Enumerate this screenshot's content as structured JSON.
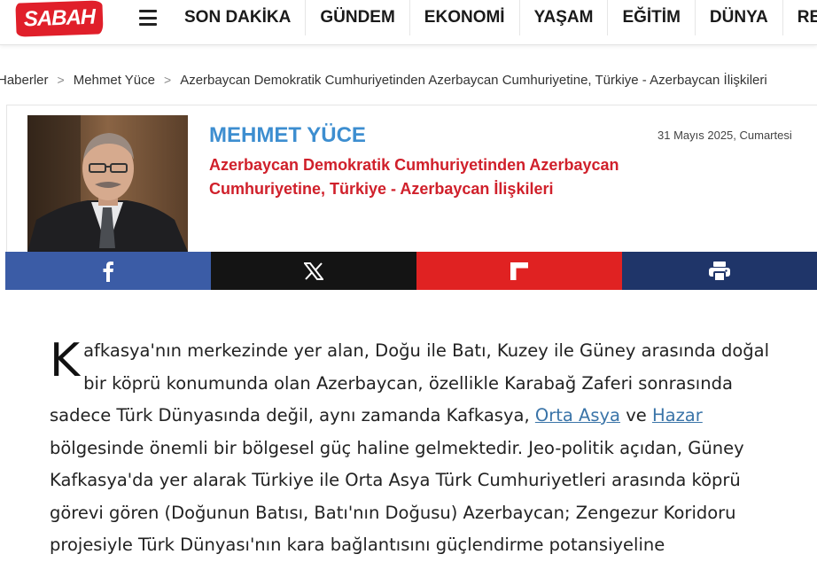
{
  "header": {
    "logo_text": "SABAH",
    "nav": [
      "SON DAKİKA",
      "GÜNDEM",
      "EKONOMİ",
      "YAŞAM",
      "EĞİTİM",
      "DÜNYA",
      "RES"
    ]
  },
  "breadcrumb": [
    "Haberler",
    "Mehmet Yüce",
    "Azerbaycan Demokratik Cumhuriyetinden Azerbaycan Cumhuriyetine, Türkiye - Azerbaycan İlişkileri"
  ],
  "author": {
    "name": "MEHMET YÜCE",
    "date": "31 Mayıs 2025, Cumartesi",
    "headline": "Azerbaycan Demokratik Cumhuriyetinden Azerbaycan Cumhuriyetine, Türkiye - Azerbaycan İlişkileri"
  },
  "share": {
    "facebook_icon": "facebook-icon",
    "x_icon": "x-icon",
    "flipboard_icon": "flipboard-icon",
    "print_icon": "print-icon",
    "colors": {
      "facebook": "#3b5ca6",
      "x": "#141414",
      "flipboard": "#e02222",
      "print": "#1f3569"
    }
  },
  "article": {
    "dropcap": "K",
    "p1_a": "afkasya'nın merkezinde yer alan, Doğu ile Batı, Kuzey ile Güney arasında doğal bir köprü konumunda olan Azerbaycan, özellikle Karabağ Zaferi sonrasında sadece Türk Dünyasında değil, aynı zamanda Kafkasya, ",
    "link1": "Orta Asya",
    "p1_b": " ve ",
    "link2": "Hazar",
    "p1_c": " bölgesinde önemli bir bölgesel güç haline gelmektedir. Jeo-politik açıdan, Güney Kafkasya'da yer alarak Türkiye ile Orta Asya Türk Cumhuriyetleri arasında köprü görevi gören (Doğunun Batısı, Batı'nın Doğusu) Azerbaycan; Zengezur Koridoru projesiyle Türk Dünyası'nın kara bağlantısını güçlendirme potansiyeline"
  }
}
